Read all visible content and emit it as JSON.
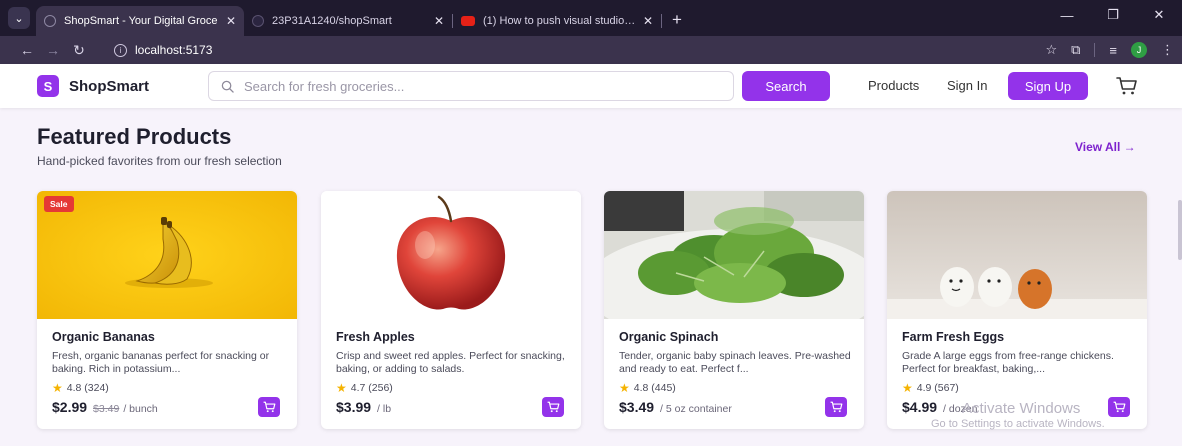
{
  "browser": {
    "tabs": [
      {
        "title": "ShopSmart - Your Digital Groce",
        "active": true
      },
      {
        "title": "23P31A1240/shopSmart",
        "active": false
      },
      {
        "title": "(1) How to push visual studio co",
        "active": false
      }
    ],
    "url": "localhost:5173",
    "profile_initial": "J"
  },
  "header": {
    "logo_mark": "S",
    "logo_text": "ShopSmart",
    "search_placeholder": "Search for fresh groceries...",
    "search_button": "Search",
    "nav_products": "Products",
    "nav_signin": "Sign In",
    "nav_signup": "Sign Up"
  },
  "section": {
    "title": "Featured Products",
    "subtitle": "Hand-picked favorites from our fresh selection",
    "view_all": "View All →"
  },
  "products": [
    {
      "name": "Organic Bananas",
      "description": "Fresh, organic bananas perfect for snacking or baking. Rich in potassium...",
      "rating": "4.8 (324)",
      "price": "$2.99",
      "old_price": "$3.49",
      "unit": "/ bunch",
      "badge": "Sale",
      "image_icon": "banana-image"
    },
    {
      "name": "Fresh Apples",
      "description": "Crisp and sweet red apples. Perfect for snacking, baking, or adding to salads.",
      "rating": "4.7 (256)",
      "price": "$3.99",
      "old_price": "",
      "unit": "/ lb",
      "badge": "",
      "image_icon": "apple-image"
    },
    {
      "name": "Organic Spinach",
      "description": "Tender, organic baby spinach leaves. Pre-washed and ready to eat. Perfect f...",
      "rating": "4.8 (445)",
      "price": "$3.49",
      "old_price": "",
      "unit": "/ 5 oz container",
      "badge": "",
      "image_icon": "spinach-image"
    },
    {
      "name": "Farm Fresh Eggs",
      "description": "Grade A large eggs from free-range chickens. Perfect for breakfast, baking,...",
      "rating": "4.9 (567)",
      "price": "$4.99",
      "old_price": "",
      "unit": "/ dozen",
      "badge": "",
      "image_icon": "eggs-image"
    }
  ],
  "watermark": {
    "title": "Activate Windows",
    "subtitle": "Go to Settings to activate Windows."
  },
  "colors": {
    "brand": "#9333ea",
    "sale": "#e53935",
    "star": "#f5b301"
  }
}
